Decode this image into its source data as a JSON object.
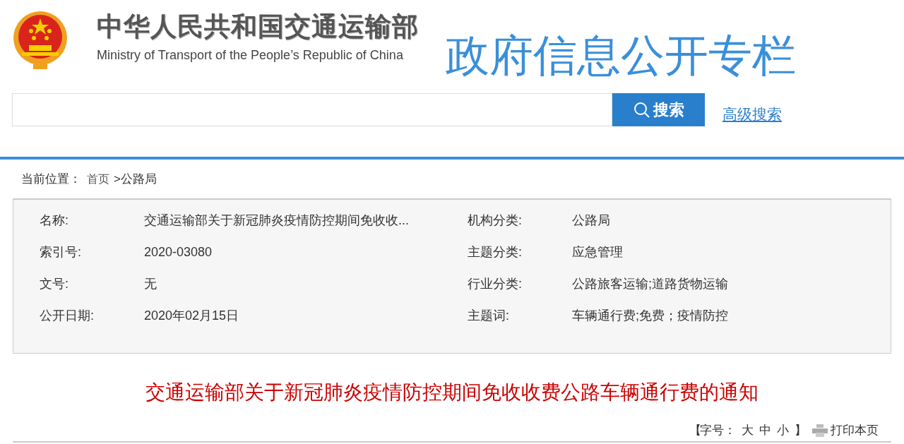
{
  "header": {
    "title_cn": "中华人民共和国交通运输部",
    "title_en": "Ministry of Transport of the People’s Republic of China",
    "column_title": "政府信息公开专栏"
  },
  "search": {
    "button": "搜索",
    "advanced_link": "高级搜索"
  },
  "breadcrumb": {
    "label": "当前位置：",
    "home": "首页",
    "separator": ">",
    "current": "公路局"
  },
  "info": [
    {
      "label": "名称:",
      "value": "交通运输部关于新冠肺炎疫情防控期间免收收...",
      "label_2": "机构分类:",
      "value_2": "公路局"
    },
    {
      "label": "索引号:",
      "value": "2020-03080",
      "label_2": "主题分类:",
      "value_2": "应急管理"
    },
    {
      "label": "文号:",
      "value": "无",
      "label_2": "行业分类:",
      "value_2": "公路旅客运输;道路货物运输"
    },
    {
      "label": "公开日期:",
      "value": "2020年02月15日",
      "label_2": "主题词:",
      "value_2": "车辆通行费;免费；疫情防控"
    }
  ],
  "article_title": "交通运输部关于新冠肺炎疫情防控期间免收收费公路车辆通行费的通知",
  "font_tools": {
    "open_bracket": "【",
    "label": "字号：",
    "sizes": [
      "大",
      "中",
      "小"
    ],
    "close_bracket": "】",
    "print": "打印本页"
  }
}
